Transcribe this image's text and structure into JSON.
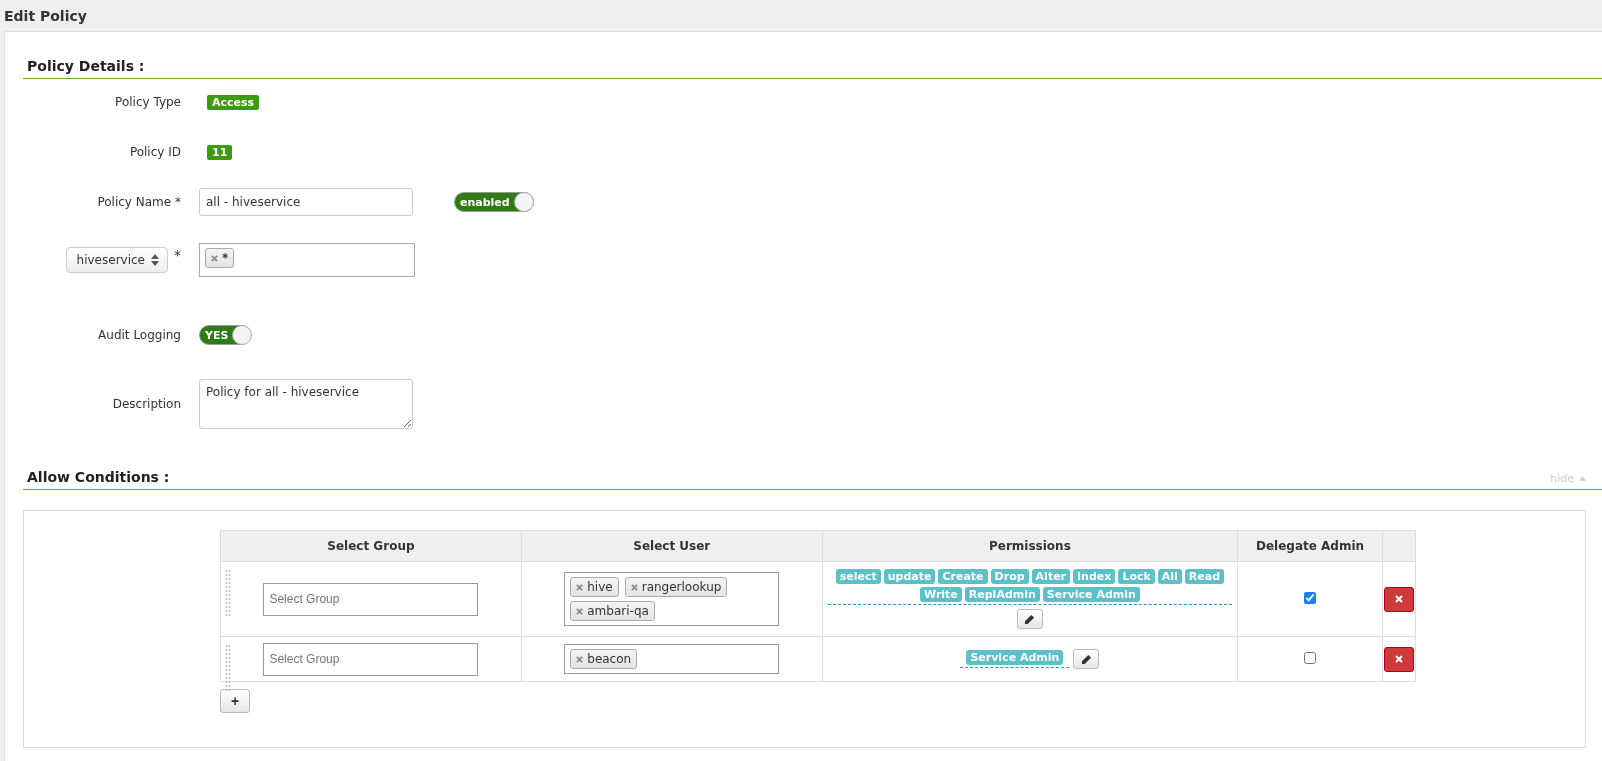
{
  "page_title": "Edit Policy",
  "policy_details": {
    "heading": "Policy Details :",
    "policy_type": {
      "label": "Policy Type",
      "value": "Access"
    },
    "policy_id": {
      "label": "Policy ID",
      "value": "11"
    },
    "policy_name": {
      "label": "Policy Name *",
      "value": "all - hiveservice",
      "status_toggle": {
        "label": "enabled",
        "on": true
      }
    },
    "resource": {
      "selector": "hiveservice",
      "required_mark": "*",
      "values": [
        "*"
      ]
    },
    "audit_logging": {
      "label": "Audit Logging",
      "toggle": {
        "label": "YES",
        "on": true
      }
    },
    "description": {
      "label": "Description",
      "value": "Policy for all - hiveservice"
    }
  },
  "allow_conditions": {
    "heading": "Allow Conditions :",
    "hide_link": "hide",
    "table": {
      "columns": [
        "Select Group",
        "Select User",
        "Permissions",
        "Delegate Admin"
      ],
      "rows": [
        {
          "group_placeholder": "Select Group",
          "users": [
            "hive",
            "rangerlookup",
            "ambari-qa"
          ],
          "permissions": [
            "select",
            "update",
            "Create",
            "Drop",
            "Alter",
            "Index",
            "Lock",
            "All",
            "Read",
            "Write",
            "ReplAdmin",
            "Service Admin"
          ],
          "delegate_admin": true
        },
        {
          "group_placeholder": "Select Group",
          "users": [
            "beacon"
          ],
          "permissions": [
            "Service Admin"
          ],
          "delegate_admin": false
        }
      ]
    },
    "add_button": "+"
  }
}
